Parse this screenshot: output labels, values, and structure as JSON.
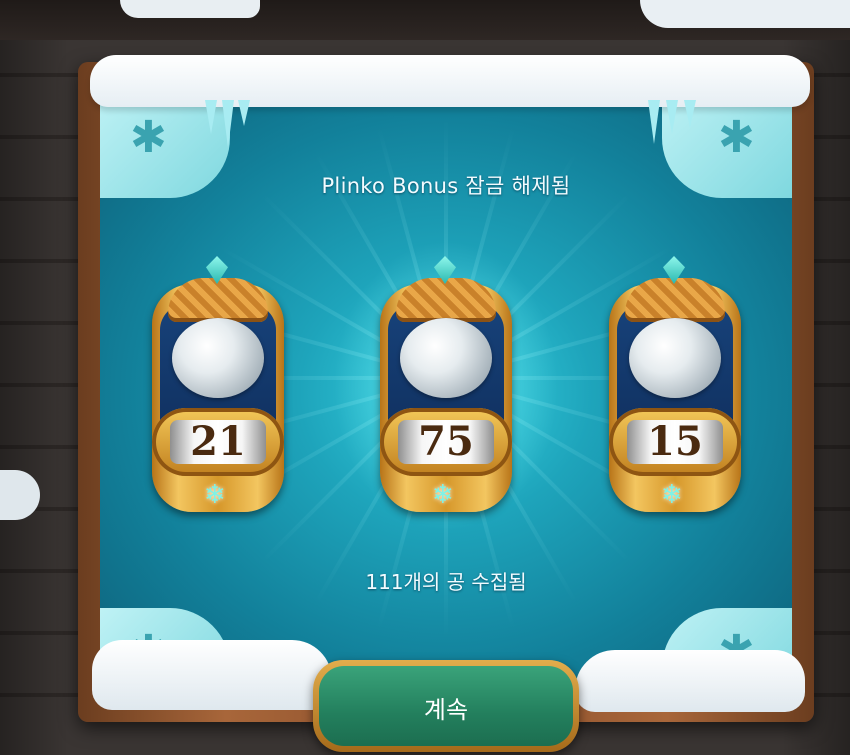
{
  "dialog": {
    "title": "Plinko Bonus 잠금 해제됨",
    "summary": "111개의 공 수집됨",
    "continue_label": "계속"
  },
  "cards": [
    {
      "value": "21",
      "highlighted": false
    },
    {
      "value": "75",
      "highlighted": true
    },
    {
      "value": "15",
      "highlighted": false
    }
  ],
  "icons": {
    "corner": "snowflake-icon",
    "gem": "gem-icon",
    "ball": "plinko-ball-icon"
  },
  "colors": {
    "panel": "#1ea4bb",
    "button": "#237f5d",
    "gold": "#d6972a"
  }
}
